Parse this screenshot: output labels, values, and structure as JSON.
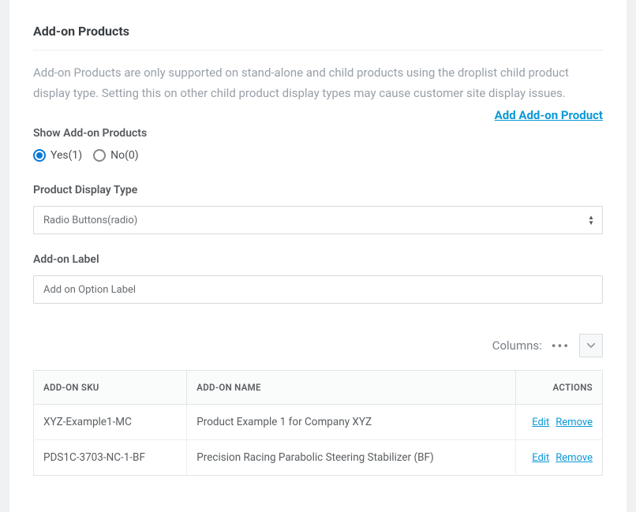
{
  "section": {
    "title": "Add-on Products",
    "description": "Add-on Products are only supported on stand-alone and child products using the droplist child product display type. Setting this on other child product display types may cause customer site display issues.",
    "add_link": "Add Add-on Product"
  },
  "show_addon": {
    "label": "Show Add-on Products",
    "yes": "Yes(1)",
    "no": "No(0)"
  },
  "display_type": {
    "label": "Product Display Type",
    "value": "Radio Buttons(radio)"
  },
  "addon_label": {
    "label": "Add-on Label",
    "value": "Add on Option Label"
  },
  "columns_toolbar": {
    "label": "Columns:"
  },
  "table": {
    "headers": {
      "sku": "ADD-ON SKU",
      "name": "ADD-ON NAME",
      "actions": "ACTIONS"
    },
    "actions": {
      "edit": "Edit",
      "remove": "Remove"
    },
    "rows": [
      {
        "sku": "XYZ-Example1-MC",
        "name": "Product Example 1 for Company XYZ"
      },
      {
        "sku": "PDS1C-3703-NC-1-BF",
        "name": "Precision Racing Parabolic Steering Stabilizer (BF)"
      }
    ]
  }
}
